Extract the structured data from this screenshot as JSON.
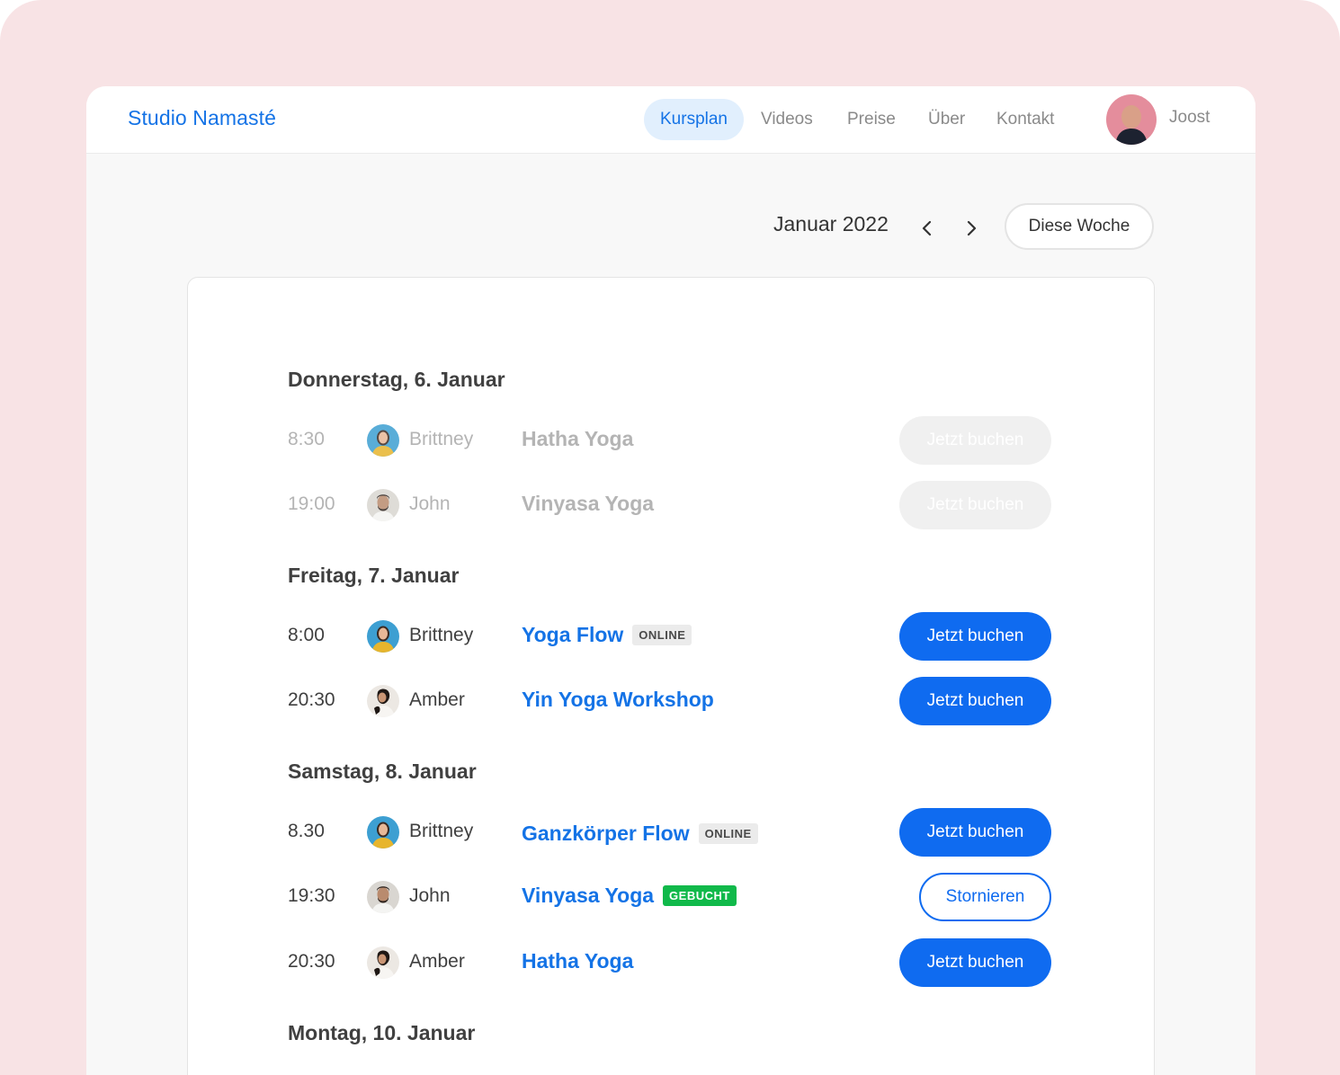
{
  "brand": "Studio Namasté",
  "nav": [
    {
      "label": "Kursplan",
      "active": true
    },
    {
      "label": "Videos",
      "active": false
    },
    {
      "label": "Preise",
      "active": false
    },
    {
      "label": "Über",
      "active": false
    },
    {
      "label": "Kontakt",
      "active": false
    }
  ],
  "user": {
    "name": "Joost"
  },
  "calendar": {
    "month": "Januar 2022",
    "prev_icon": "chevron-left-icon",
    "next_icon": "chevron-right-icon",
    "this_week_label": "Diese Woche"
  },
  "days": [
    {
      "heading": "Donnerstag, 6. Januar",
      "classes": [
        {
          "time": "8:30",
          "teacher": "Brittney",
          "title": "Hatha Yoga",
          "badge": "",
          "action": "Jetzt buchen",
          "state": "past"
        },
        {
          "time": "19:00",
          "teacher": "John",
          "title": "Vinyasa Yoga",
          "badge": "",
          "action": "Jetzt buchen",
          "state": "past"
        }
      ]
    },
    {
      "heading": "Freitag, 7. Januar",
      "classes": [
        {
          "time": "8:00",
          "teacher": "Brittney",
          "title": "Yoga Flow",
          "badge": "ONLINE",
          "action": "Jetzt buchen",
          "state": "open"
        },
        {
          "time": "20:30",
          "teacher": "Amber",
          "title": "Yin Yoga Workshop",
          "badge": "",
          "action": "Jetzt buchen",
          "state": "open"
        }
      ]
    },
    {
      "heading": "Samstag, 8. Januar",
      "classes": [
        {
          "time": "8.30",
          "teacher": "Brittney",
          "title": "Ganzkörper Flow",
          "badge": "ONLINE",
          "action": "Jetzt buchen",
          "state": "open"
        },
        {
          "time": "19:30",
          "teacher": "John",
          "title": "Vinyasa Yoga",
          "badge": "GEBUCHT",
          "action": "Stornieren",
          "state": "booked"
        },
        {
          "time": "20:30",
          "teacher": "Amber",
          "title": "Hatha Yoga",
          "badge": "",
          "action": "Jetzt buchen",
          "state": "open"
        }
      ]
    },
    {
      "heading": "Montag, 10. Januar",
      "classes": []
    }
  ],
  "colors": {
    "accent": "#1473e6",
    "button": "#0f6bf0",
    "booked_badge": "#10b94a",
    "background": "#f8e3e5"
  }
}
